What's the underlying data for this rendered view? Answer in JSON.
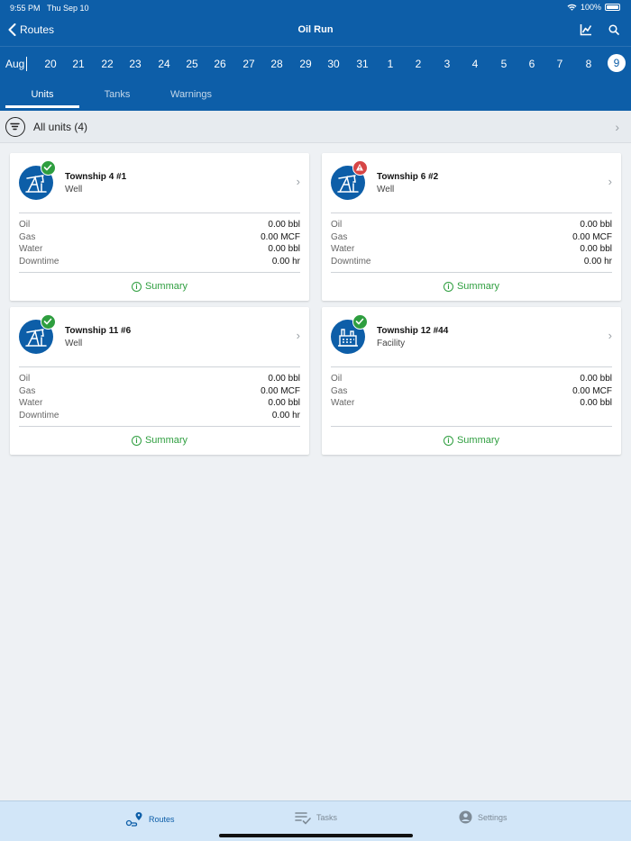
{
  "status": {
    "time": "9:55 PM",
    "date": "Thu Sep 10",
    "battery": "100%"
  },
  "nav": {
    "back_label": "Routes",
    "title": "Oil Run"
  },
  "dates": {
    "month": "Aug",
    "days": [
      "20",
      "21",
      "22",
      "23",
      "24",
      "25",
      "26",
      "27",
      "28",
      "29",
      "30",
      "31",
      "1",
      "2",
      "3",
      "4",
      "5",
      "6",
      "7",
      "8"
    ],
    "selected": "9"
  },
  "tabs": [
    "Units",
    "Tanks",
    "Warnings"
  ],
  "filter": {
    "label": "All units (4)"
  },
  "cards": [
    {
      "name": "Township 4 #1",
      "type": "Well",
      "status": "ok",
      "metrics": [
        {
          "label": "Oil",
          "value": "0.00 bbl"
        },
        {
          "label": "Gas",
          "value": "0.00 MCF"
        },
        {
          "label": "Water",
          "value": "0.00 bbl"
        },
        {
          "label": "Downtime",
          "value": "0.00 hr"
        }
      ],
      "summary": "Summary"
    },
    {
      "name": "Township 6 #2",
      "type": "Well",
      "status": "warning",
      "metrics": [
        {
          "label": "Oil",
          "value": "0.00 bbl"
        },
        {
          "label": "Gas",
          "value": "0.00 MCF"
        },
        {
          "label": "Water",
          "value": "0.00 bbl"
        },
        {
          "label": "Downtime",
          "value": "0.00 hr"
        }
      ],
      "summary": "Summary"
    },
    {
      "name": "Township 11 #6",
      "type": "Well",
      "status": "ok",
      "metrics": [
        {
          "label": "Oil",
          "value": "0.00 bbl"
        },
        {
          "label": "Gas",
          "value": "0.00 MCF"
        },
        {
          "label": "Water",
          "value": "0.00 bbl"
        },
        {
          "label": "Downtime",
          "value": "0.00 hr"
        }
      ],
      "summary": "Summary"
    },
    {
      "name": "Township 12 #44",
      "type": "Facility",
      "status": "ok",
      "metrics": [
        {
          "label": "Oil",
          "value": "0.00 bbl"
        },
        {
          "label": "Gas",
          "value": "0.00 MCF"
        },
        {
          "label": "Water",
          "value": "0.00 bbl"
        }
      ],
      "summary": "Summary"
    }
  ],
  "bottom_nav": [
    {
      "label": "Routes",
      "icon": "routes-icon",
      "active": true
    },
    {
      "label": "Tasks",
      "icon": "tasks-icon",
      "active": false
    },
    {
      "label": "Settings",
      "icon": "settings-icon",
      "active": false
    }
  ],
  "colors": {
    "brand": "#0d5ea8",
    "ok": "#2e9e3f",
    "warning": "#d64545",
    "background": "#eef1f4"
  }
}
